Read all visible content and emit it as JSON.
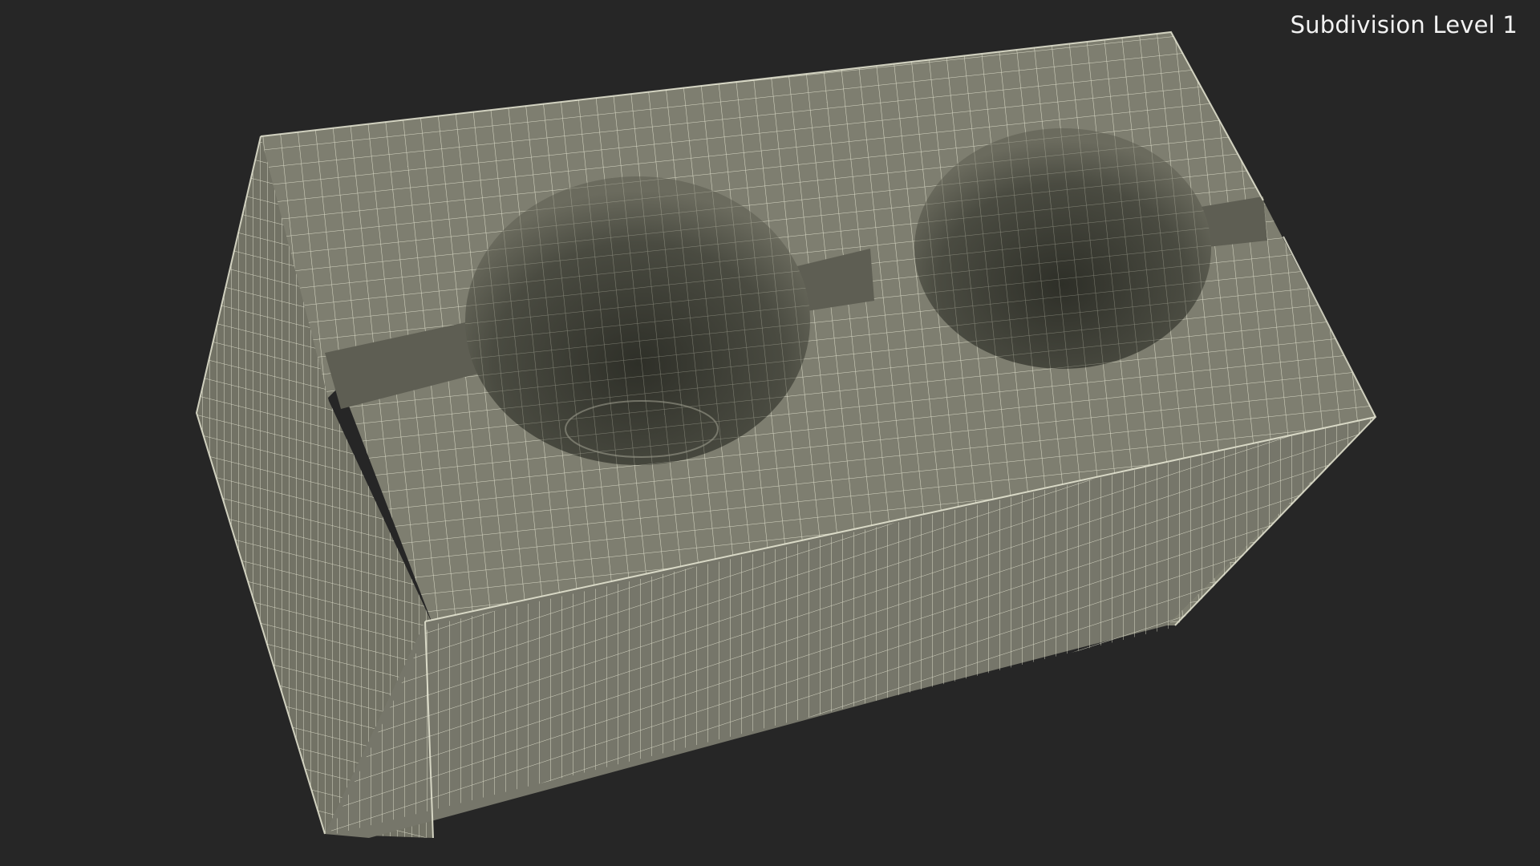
{
  "viewport": {
    "overlay_label": "Subdivision Level 1",
    "background_color": "#262626"
  },
  "model": {
    "object": "double cup holder block",
    "display_mode": "wireframe on shaded",
    "surface_color": "#7d7d6f",
    "wire_color": "#e8e8d4",
    "hole_shadow_color": "#3a3b33"
  }
}
